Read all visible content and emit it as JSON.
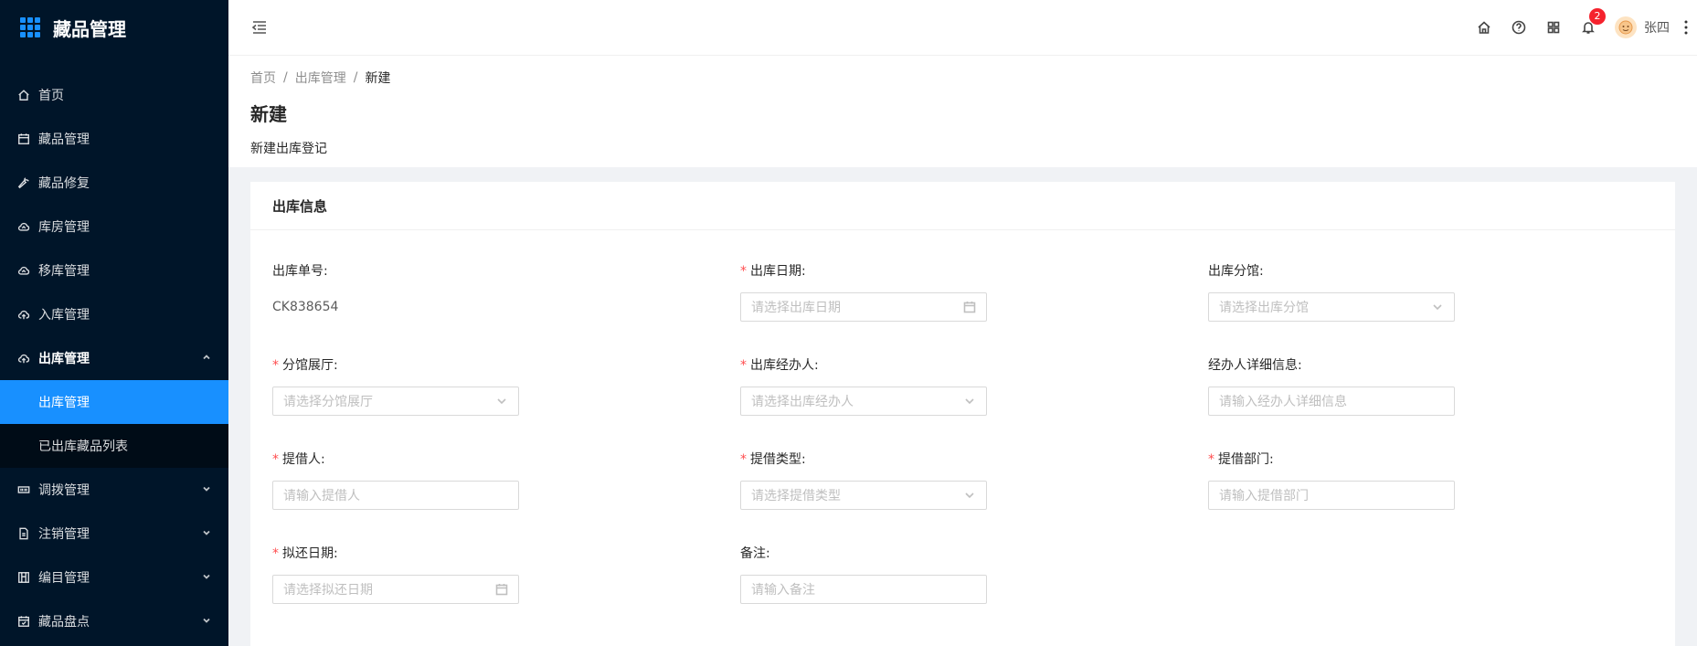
{
  "app": {
    "title": "藏品管理"
  },
  "sidebar": {
    "items": [
      {
        "label": "首页",
        "icon": "home-icon"
      },
      {
        "label": "藏品管理",
        "icon": "calendar-icon"
      },
      {
        "label": "藏品修复",
        "icon": "wrench-icon"
      },
      {
        "label": "库房管理",
        "icon": "cloud-icon"
      },
      {
        "label": "移库管理",
        "icon": "cloud-icon"
      },
      {
        "label": "入库管理",
        "icon": "cloud-upload-icon"
      },
      {
        "label": "出库管理",
        "icon": "cloud-upload-icon",
        "expanded": true,
        "children": [
          {
            "label": "出库管理",
            "active": true
          },
          {
            "label": "已出库藏品列表"
          }
        ]
      },
      {
        "label": "调拨管理",
        "icon": "transfer-icon"
      },
      {
        "label": "注销管理",
        "icon": "file-icon"
      },
      {
        "label": "编目管理",
        "icon": "catalog-icon"
      },
      {
        "label": "藏品盘点",
        "icon": "inventory-icon"
      }
    ]
  },
  "header": {
    "notification_count": "2",
    "user_name": "张四"
  },
  "breadcrumb": [
    "首页",
    "出库管理",
    "新建"
  ],
  "page": {
    "title": "新建",
    "description": "新建出库登记"
  },
  "card": {
    "title": "出库信息"
  },
  "form": {
    "order_no": {
      "label": "出库单号:",
      "value": "CK838654"
    },
    "out_date": {
      "label": "出库日期:",
      "placeholder": "请选择出库日期",
      "required": true
    },
    "branch": {
      "label": "出库分馆:",
      "placeholder": "请选择出库分馆",
      "required": false
    },
    "hall": {
      "label": "分馆展厅:",
      "placeholder": "请选择分馆展厅",
      "required": true
    },
    "handler": {
      "label": "出库经办人:",
      "placeholder": "请选择出库经办人",
      "required": true
    },
    "handler_info": {
      "label": "经办人详细信息:",
      "placeholder": "请输入经办人详细信息",
      "required": false
    },
    "borrower": {
      "label": "提借人:",
      "placeholder": "请输入提借人",
      "required": true
    },
    "borrow_type": {
      "label": "提借类型:",
      "placeholder": "请选择提借类型",
      "required": true
    },
    "borrow_dept": {
      "label": "提借部门:",
      "placeholder": "请输入提借部门",
      "required": true
    },
    "return_date": {
      "label": "拟还日期:",
      "placeholder": "请选择拟还日期",
      "required": true
    },
    "remark": {
      "label": "备注:",
      "placeholder": "请输入备注",
      "required": false
    }
  },
  "colors": {
    "sidebar_bg": "#001529",
    "primary": "#1890ff",
    "required": "#ff4d4f"
  }
}
